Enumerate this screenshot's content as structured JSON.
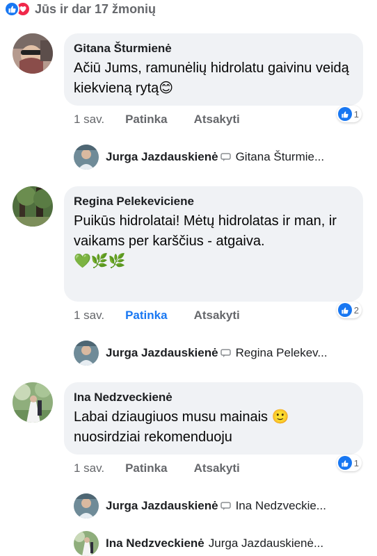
{
  "header": {
    "reactions_text": "Jūs ir dar 17 žmonių",
    "reaction_icons": [
      "like-icon",
      "love-icon"
    ]
  },
  "comments": [
    {
      "author": "Gitana Šturmienė",
      "text": "Ačiū Jums, ramunėlių hidrolatu gaivinu veidą kiekvieną rytą😊",
      "time": "1 sav.",
      "like_label": "Patinka",
      "like_active": false,
      "reply_label": "Atsakyti",
      "reaction_count": "1",
      "reply": {
        "author": "Jurga Jazdauskienė",
        "target": "Gitana Šturmie..."
      }
    },
    {
      "author": "Regina Pelekeviciene",
      "text": "Puikūs hidrolatai! Mėtų hidrolatas ir man, ir vaikams per karščius - atgaiva.\n💚🌿🌿",
      "time": "1 sav.",
      "like_label": "Patinka",
      "like_active": true,
      "reply_label": "Atsakyti",
      "reaction_count": "2",
      "reply": {
        "author": "Jurga Jazdauskienė",
        "target": "Regina Pelekev..."
      }
    },
    {
      "author": "Ina Nedzveckienė",
      "text": "Labai dziaugiuos musu mainais 🙂 nuosirdziai rekomenduoju",
      "time": "1 sav.",
      "like_label": "Patinka",
      "like_active": false,
      "reply_label": "Atsakyti",
      "reaction_count": "1",
      "replies": [
        {
          "author": "Jurga Jazdauskienė",
          "target": "Ina Nedzveckie..."
        },
        {
          "author": "Ina Nedzveckienė",
          "target": "Jurga Jazdauskienė..."
        }
      ]
    }
  ],
  "colors": {
    "bubble": "#f0f2f5",
    "accent": "#1877f2",
    "love": "#f0284a",
    "muted": "#65676b"
  }
}
